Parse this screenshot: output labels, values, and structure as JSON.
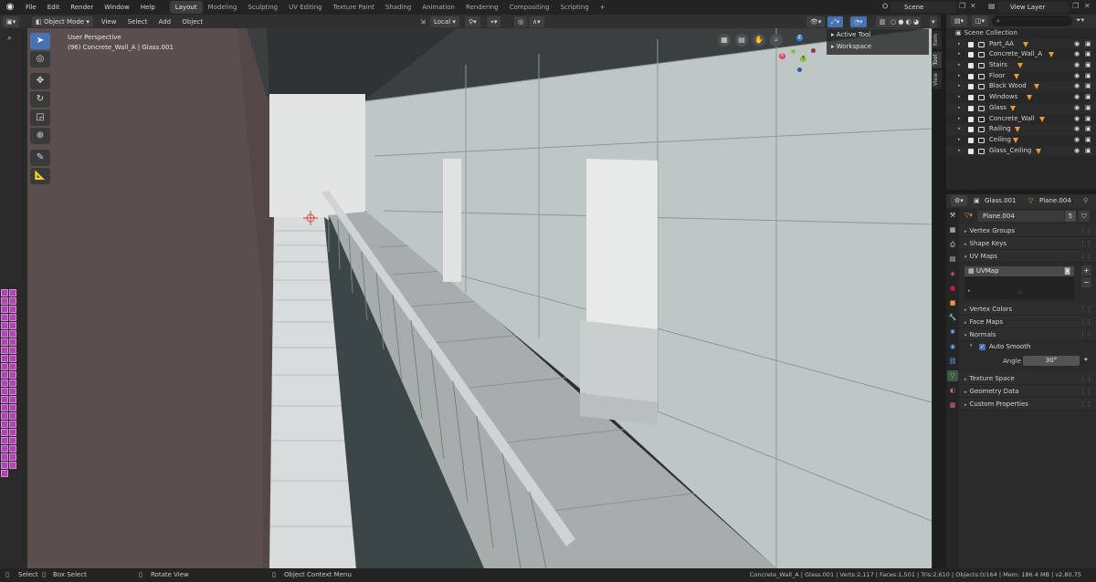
{
  "menu": [
    "File",
    "Edit",
    "Render",
    "Window",
    "Help"
  ],
  "workspaces": [
    {
      "label": "Layout",
      "active": true
    },
    {
      "label": "Modeling"
    },
    {
      "label": "Sculpting"
    },
    {
      "label": "UV Editing"
    },
    {
      "label": "Texture Paint"
    },
    {
      "label": "Shading"
    },
    {
      "label": "Animation"
    },
    {
      "label": "Rendering"
    },
    {
      "label": "Compositing"
    },
    {
      "label": "Scripting"
    }
  ],
  "add_workspace": "+",
  "scene": {
    "label": "Scene"
  },
  "view_layer": {
    "label": "View Layer"
  },
  "viewport_header": {
    "mode": "Object Mode",
    "menus": [
      "View",
      "Select",
      "Add",
      "Object"
    ],
    "orientation": "Local"
  },
  "viewport_info": {
    "line1": "User Perspective",
    "line2": "(96) Concrete_Wall_A | Glass.001"
  },
  "n_panel": {
    "active_tool": "Active Tool",
    "workspace": "Workspace",
    "tabs": [
      "Item",
      "Tool",
      "View"
    ]
  },
  "gizmo": {
    "x": "X",
    "y": "Y",
    "z": "Z"
  },
  "outliner": {
    "root": "Scene Collection",
    "search_placeholder": "",
    "items": [
      {
        "name": "Part_AA"
      },
      {
        "name": "Concrete_Wall_A"
      },
      {
        "name": "Stairs"
      },
      {
        "name": "Floor"
      },
      {
        "name": "Black Wood"
      },
      {
        "name": "Windows"
      },
      {
        "name": "Glass"
      },
      {
        "name": "Concrete_Wall"
      },
      {
        "name": "Railing"
      },
      {
        "name": "Ceiling"
      },
      {
        "name": "Glass_Ceiling"
      }
    ]
  },
  "properties": {
    "object": "Glass.001",
    "mesh": "Plane.004",
    "data_name": "Plane.004",
    "users": "5",
    "sections": {
      "vertex_groups": "Vertex Groups",
      "shape_keys": "Shape Keys",
      "uv_maps": "UV Maps",
      "uv_map_item": "UVMap",
      "vertex_colors": "Vertex Colors",
      "face_maps": "Face Maps",
      "normals": "Normals",
      "auto_smooth": "Auto Smooth",
      "angle_label": "Angle",
      "angle_value": "30°",
      "texture_space": "Texture Space",
      "geometry_data": "Geometry Data",
      "custom_properties": "Custom Properties"
    }
  },
  "statusbar": {
    "select": "Select",
    "box_select": "Box Select",
    "rotate_view": "Rotate View",
    "context_menu": "Object Context Menu",
    "stats": "Concrete_Wall_A | Glass.001 | Verts:2,117 | Faces:1,501 | Tris:2,610 | Objects:0/164 | Mem: 186.4 MB | v2.80.75"
  },
  "colors": {
    "accent": "#4772b3",
    "object_orange": "#e89a3a",
    "axis_x": "#e8465a",
    "axis_y": "#8ac43a",
    "axis_z": "#3a82e8"
  }
}
